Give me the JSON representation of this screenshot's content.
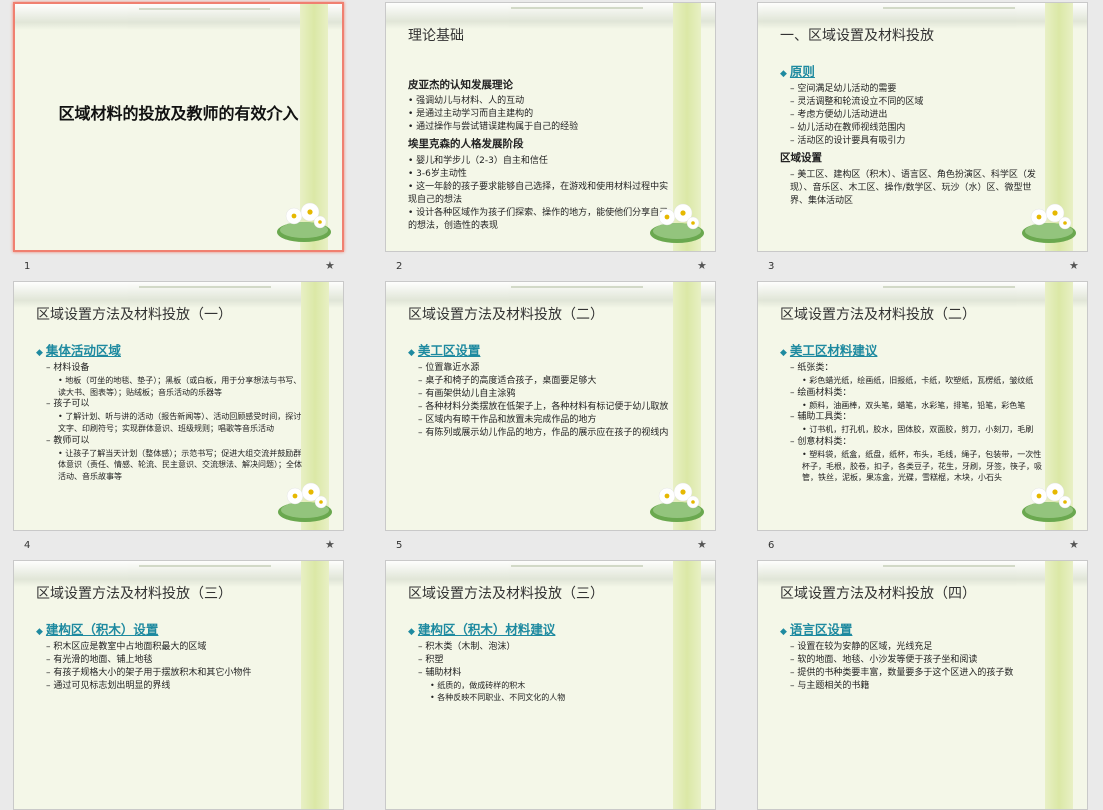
{
  "slides": [
    {
      "number": "1",
      "big_title": "区域材料的投放及教师的有效介入"
    },
    {
      "number": "2",
      "title": "理论基础",
      "lines": [
        {
          "cls": "sub-h",
          "text": "皮亚杰的认知发展理论"
        },
        {
          "cls": "dot",
          "text": "强调幼儿与材料、人的互动"
        },
        {
          "cls": "dot",
          "text": "是通过主动学习而自主建构的"
        },
        {
          "cls": "dot",
          "text": "通过操作与尝试错误建构属于自己的经验"
        },
        {
          "cls": "sub-h",
          "text": "埃里克森的人格发展阶段"
        },
        {
          "cls": "dot",
          "text": "婴儿和学步儿（2-3）自主和信任"
        },
        {
          "cls": "dot",
          "text": "3-6岁主动性"
        },
        {
          "cls": "dot",
          "text": "这一年龄的孩子要求能够自己选择，在游戏和使用材料过程中实现自己的想法"
        },
        {
          "cls": "dot",
          "text": "设计各种区域作为孩子们探索、操作的地方，能使他们分享自己的想法，创造性的表现"
        }
      ]
    },
    {
      "number": "3",
      "title": "一、区域设置及材料投放",
      "lines": [
        {
          "cls": "h-blue",
          "text": "原则"
        },
        {
          "cls": "dash ind1",
          "text": "空间满足幼儿活动的需要"
        },
        {
          "cls": "dash ind1",
          "text": "灵活调整和轮流设立不同的区域"
        },
        {
          "cls": "dash ind1",
          "text": "考虑方便幼儿活动进出"
        },
        {
          "cls": "dash ind1",
          "text": "幼儿活动在教师视线范围内"
        },
        {
          "cls": "dash ind1",
          "text": "活动区的设计要具有吸引力"
        },
        {
          "cls": "sub-h",
          "text": "区域设置"
        },
        {
          "cls": "dash ind1",
          "text": "美工区、建构区（积木）、语言区、角色扮演区、科学区（发现）、音乐区、木工区、操作/数学区、玩沙（水）区、微型世界、集体活动区"
        }
      ]
    },
    {
      "number": "4",
      "title": "区域设置方法及材料投放（一）",
      "lines": [
        {
          "cls": "h-blue",
          "text": "集体活动区域"
        },
        {
          "cls": "dash ind1",
          "text": "材料设备"
        },
        {
          "cls": "dot ind2",
          "text": "地板（可坐的地毯、垫子）；黑板（或白板，用于分享想法与书写、读大书、图表等）；贴绒板；音乐活动的乐器等"
        },
        {
          "cls": "dash ind1",
          "text": "孩子可以"
        },
        {
          "cls": "dot ind2",
          "text": "了解计划、听与讲的活动（报告新闻等）、活动回顾感受时间，探讨文字、印刷符号；实现群体意识、班级规则；唱歌等音乐活动"
        },
        {
          "cls": "dash ind1",
          "text": "教师可以"
        },
        {
          "cls": "dot ind2",
          "text": "让孩子了解当天计划（整体感）；示范书写；促进大组交流并鼓励群体意识（责任、情感、轮流、民主意识、交流想法、解决问题）；全体活动、音乐故事等"
        }
      ]
    },
    {
      "number": "5",
      "title": "区域设置方法及材料投放（二）",
      "lines": [
        {
          "cls": "h-blue",
          "text": "美工区设置"
        },
        {
          "cls": "dash ind1",
          "text": "位置靠近水源"
        },
        {
          "cls": "dash ind1",
          "text": "桌子和椅子的高度适合孩子，桌面要足够大"
        },
        {
          "cls": "dash ind1",
          "text": "有画架供幼儿自主涂鸦"
        },
        {
          "cls": "dash ind1",
          "text": "各种材料分类摆放在低架子上，各种材料有标记便于幼儿取放"
        },
        {
          "cls": "dash ind1",
          "text": "区域内有晾干作品和放置未完成作品的地方"
        },
        {
          "cls": "dash ind1",
          "text": "有陈列或展示幼儿作品的地方，作品的展示应在孩子的视线内"
        }
      ]
    },
    {
      "number": "6",
      "title": "区域设置方法及材料投放（二）",
      "lines": [
        {
          "cls": "h-blue",
          "text": "美工区材料建议"
        },
        {
          "cls": "dash ind1",
          "text": "纸张类："
        },
        {
          "cls": "dot ind2",
          "text": "彩色蜡光纸，绘画纸，旧报纸，卡纸，吹塑纸，瓦楞纸，皱纹纸"
        },
        {
          "cls": "dash ind1",
          "text": "绘画材料类："
        },
        {
          "cls": "dot ind2",
          "text": "颜料，油画棒，双头笔，蜡笔，水彩笔，排笔，铅笔，彩色笔"
        },
        {
          "cls": "dash ind1",
          "text": "辅助工具类："
        },
        {
          "cls": "dot ind2",
          "text": "订书机，打孔机，胶水，固体胶，双面胶，剪刀，小刻刀，毛刷"
        },
        {
          "cls": "dash ind1",
          "text": "创意材料类："
        },
        {
          "cls": "dot ind2",
          "text": "塑料袋，纸盒，纸盘，纸杯，布头，毛线，绳子，包装带，一次性杯子，毛根，胶卷，扣子，各类豆子，花生，牙刷，牙签，筷子，吸管，铁丝，泥板，果冻盒，光碟，雪糕棍，木块，小石头"
        }
      ]
    },
    {
      "number": "7",
      "title": "区域设置方法及材料投放（三）",
      "lines": [
        {
          "cls": "h-blue",
          "text": "建构区（积木）设置"
        },
        {
          "cls": "dash ind1",
          "text": "积木区应是教室中占地面积最大的区域"
        },
        {
          "cls": "dash ind1",
          "text": "有光滑的地面、铺上地毯"
        },
        {
          "cls": "dash ind1",
          "text": "有孩子规格大小的架子用于摆放积木和其它小物件"
        },
        {
          "cls": "dash ind1",
          "text": "通过可见标志划出明显的界线"
        }
      ]
    },
    {
      "number": "8",
      "title": "区域设置方法及材料投放（三）",
      "lines": [
        {
          "cls": "h-blue",
          "text": "建构区（积木）材料建议"
        },
        {
          "cls": "dash ind1",
          "text": "积木类（木制、泡沫）"
        },
        {
          "cls": "dash ind1",
          "text": "积塑"
        },
        {
          "cls": "dash ind1",
          "text": "辅助材料"
        },
        {
          "cls": "dot ind2",
          "text": "纸质的，做成砖样的积木"
        },
        {
          "cls": "dot ind2",
          "text": "各种反映不同职业、不同文化的人物"
        }
      ]
    },
    {
      "number": "9",
      "title": "区域设置方法及材料投放（四）",
      "lines": [
        {
          "cls": "h-blue",
          "text": "语言区设置"
        },
        {
          "cls": "dash ind1",
          "text": "设置在较为安静的区域，光线充足"
        },
        {
          "cls": "dash ind1",
          "text": "软的地面、地毯、小沙发等便于孩子坐和阅读"
        },
        {
          "cls": "dash ind1",
          "text": "提供的书种类要丰富，数量要多于这个区进入的孩子数"
        },
        {
          "cls": "dash ind1",
          "text": "与主题相关的书籍"
        }
      ]
    }
  ],
  "star_icon": "★",
  "colors": {
    "accent": "#1e8aa0",
    "selected_border": "#f08070",
    "slide_bg": "#f4f7e8"
  }
}
